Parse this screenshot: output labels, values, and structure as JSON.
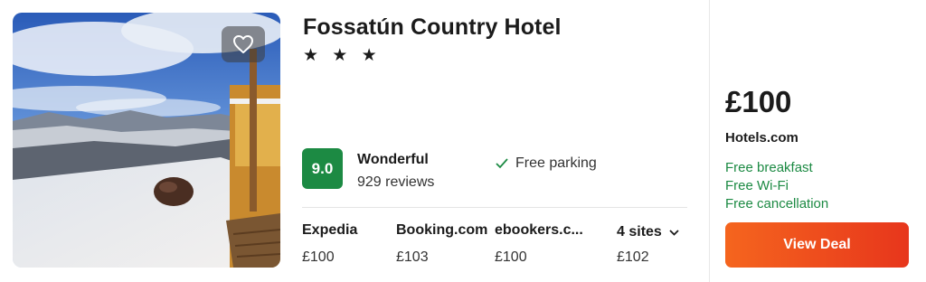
{
  "hotel": {
    "name": "Fossatún Country Hotel",
    "stars": "★ ★ ★",
    "star_count": 3,
    "score": "9.0",
    "rating_word": "Wonderful",
    "reviews": "929 reviews",
    "amenity": "Free parking"
  },
  "sites": [
    {
      "name": "Expedia",
      "price": "£100"
    },
    {
      "name": "Booking.com",
      "price": "£103"
    },
    {
      "name": "ebookers.c...",
      "price": "£100"
    }
  ],
  "more_sites": {
    "label": "4 sites",
    "price": "£102"
  },
  "deal": {
    "price": "£100",
    "provider": "Hotels.com",
    "perks": [
      "Free breakfast",
      "Free Wi-Fi",
      "Free cancellation"
    ],
    "button": "View Deal"
  },
  "colors": {
    "score_badge": "#1c8a43",
    "perk_text": "#1c8a43",
    "deal_button_start": "#f5651e",
    "deal_button_end": "#e7361c"
  },
  "icons": {
    "favorite": "heart-icon",
    "amenity": "check-icon",
    "expand": "chevron-down-icon"
  }
}
